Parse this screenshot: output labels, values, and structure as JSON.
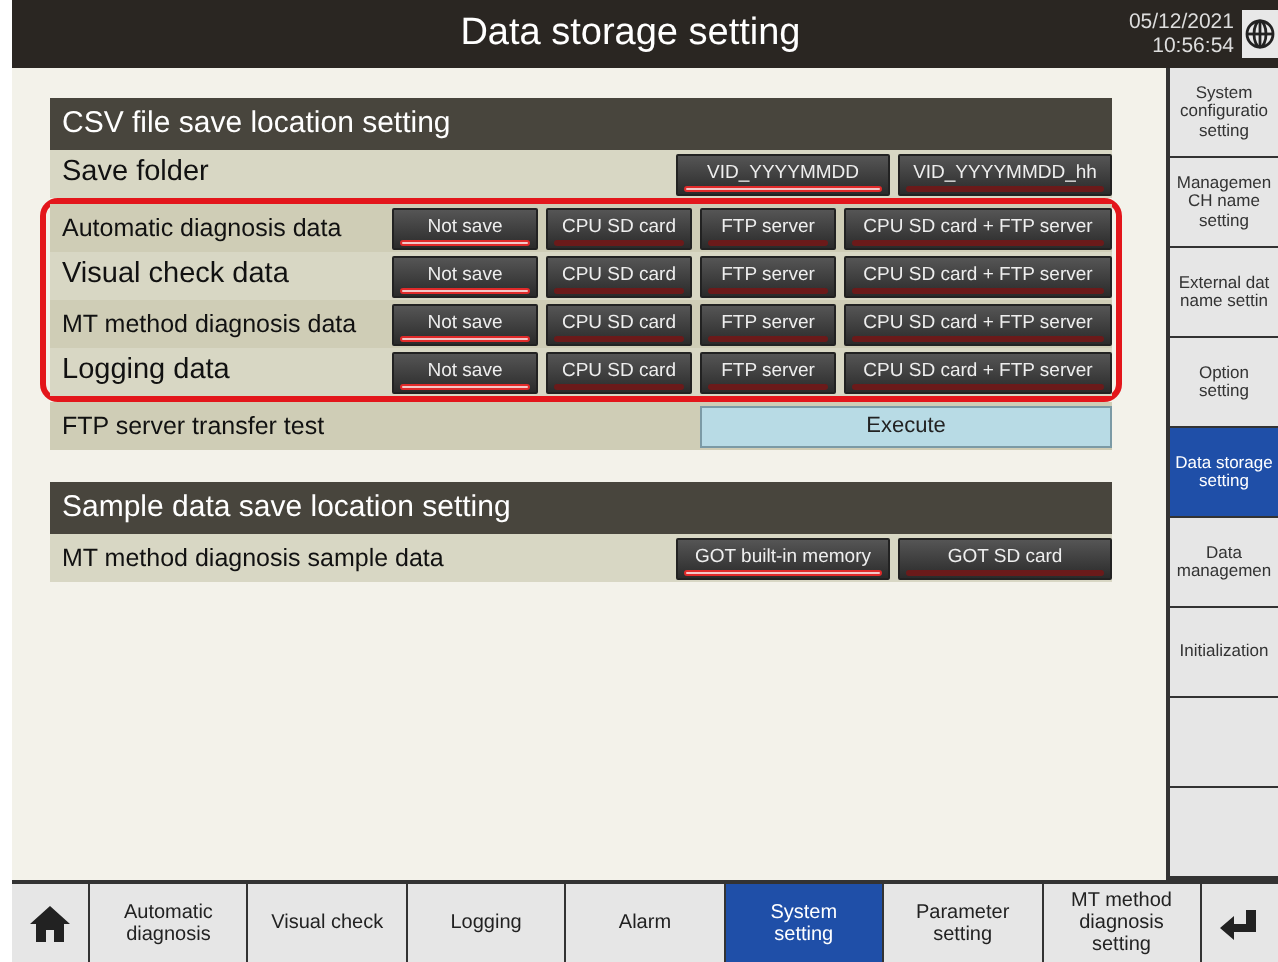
{
  "title": "Data storage setting",
  "datetime": {
    "date": "05/12/2021",
    "time": "10:56:54"
  },
  "sections": [
    {
      "title": "CSV file save location setting",
      "rows": [
        {
          "kind": "options",
          "label": "Save folder",
          "options": [
            {
              "label": "VID_YYYYMMDD",
              "selected": true
            },
            {
              "label": "VID_YYYYMMDD_hh",
              "selected": false
            }
          ]
        },
        {
          "kind": "outlined_group",
          "rows": [
            {
              "kind": "options",
              "label": "Automatic diagnosis data",
              "options": [
                {
                  "label": "Not save",
                  "selected": true
                },
                {
                  "label": "CPU SD card",
                  "selected": false
                },
                {
                  "label": "FTP server",
                  "selected": false
                },
                {
                  "label": "CPU SD card + FTP server",
                  "selected": false
                }
              ]
            },
            {
              "kind": "options",
              "label": "Visual check data",
              "options": [
                {
                  "label": "Not save",
                  "selected": true
                },
                {
                  "label": "CPU SD card",
                  "selected": false
                },
                {
                  "label": "FTP server",
                  "selected": false
                },
                {
                  "label": "CPU SD card + FTP server",
                  "selected": false
                }
              ]
            },
            {
              "kind": "options",
              "label": "MT method diagnosis data",
              "options": [
                {
                  "label": "Not save",
                  "selected": true
                },
                {
                  "label": "CPU SD card",
                  "selected": false
                },
                {
                  "label": "FTP server",
                  "selected": false
                },
                {
                  "label": "CPU SD card + FTP server",
                  "selected": false
                }
              ]
            },
            {
              "kind": "options",
              "label": "Logging data",
              "options": [
                {
                  "label": "Not save",
                  "selected": true
                },
                {
                  "label": "CPU SD card",
                  "selected": false
                },
                {
                  "label": "FTP server",
                  "selected": false
                },
                {
                  "label": "CPU SD card + FTP server",
                  "selected": false
                }
              ]
            }
          ]
        },
        {
          "kind": "action",
          "label": "FTP server transfer test",
          "button": "Execute"
        }
      ]
    },
    {
      "title": "Sample data save location setting",
      "rows": [
        {
          "kind": "options",
          "label": "MT method diagnosis sample data",
          "options": [
            {
              "label": "GOT built-in memory",
              "selected": true
            },
            {
              "label": "GOT SD card",
              "selected": false
            }
          ]
        }
      ]
    }
  ],
  "side_menu": [
    {
      "kind": "item",
      "lines": [
        "System",
        "configuratio",
        "setting"
      ],
      "selected": false
    },
    {
      "kind": "item",
      "lines": [
        "Managemen",
        "CH name",
        "setting"
      ],
      "selected": false
    },
    {
      "kind": "item",
      "lines": [
        "External dat",
        "name settin"
      ],
      "selected": false
    },
    {
      "kind": "item",
      "lines": [
        "Option",
        "setting"
      ],
      "selected": false
    },
    {
      "kind": "item",
      "lines": [
        "Data storage",
        "setting"
      ],
      "selected": true
    },
    {
      "kind": "item",
      "lines": [
        "Data",
        "managemen"
      ],
      "selected": false
    },
    {
      "kind": "item",
      "lines": [
        "Initialization"
      ],
      "selected": false
    },
    {
      "kind": "blank",
      "selected": false
    },
    {
      "kind": "blank",
      "selected": false
    }
  ],
  "bottom_nav": [
    {
      "kind": "home",
      "selected": false
    },
    {
      "kind": "tab",
      "lines": [
        "Automatic",
        "diagnosis"
      ],
      "selected": false
    },
    {
      "kind": "tab",
      "lines": [
        "Visual check"
      ],
      "selected": false
    },
    {
      "kind": "tab",
      "lines": [
        "Logging"
      ],
      "selected": false
    },
    {
      "kind": "tab",
      "lines": [
        "Alarm"
      ],
      "selected": false
    },
    {
      "kind": "tab",
      "lines": [
        "System",
        "setting"
      ],
      "selected": true
    },
    {
      "kind": "tab",
      "lines": [
        "Parameter",
        "setting"
      ],
      "selected": false
    },
    {
      "kind": "tab",
      "lines": [
        "MT method",
        "diagnosis",
        "setting"
      ],
      "selected": false
    },
    {
      "kind": "back",
      "selected": false
    }
  ]
}
